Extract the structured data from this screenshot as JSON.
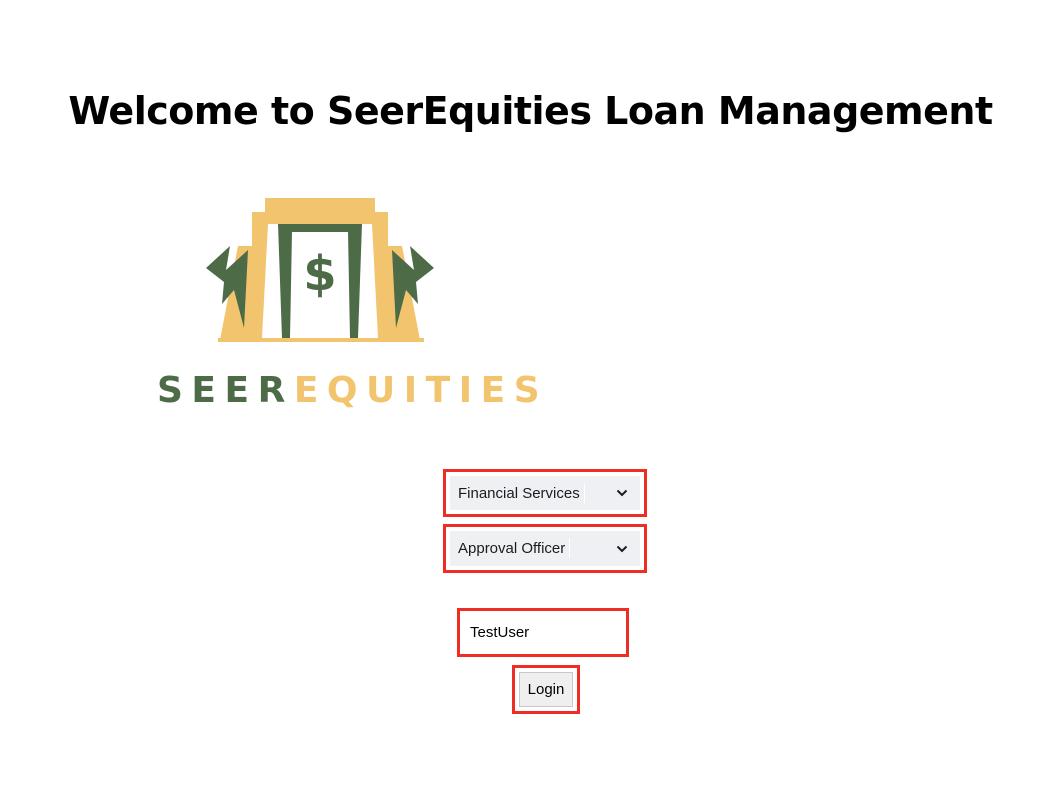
{
  "page": {
    "title": "Welcome to SeerEquities Loan Management"
  },
  "logo": {
    "word_part1": "SEER",
    "word_part2": "EQUITIES",
    "symbol": "$",
    "colors": {
      "green": "#4e6b48",
      "gold": "#f2c46e"
    }
  },
  "form": {
    "department_select": {
      "selected": "Financial Services"
    },
    "role_select": {
      "selected": "Approval Officer"
    },
    "username": {
      "value": "TestUser"
    },
    "login_label": "Login"
  },
  "highlight_color": "#ee2d24"
}
